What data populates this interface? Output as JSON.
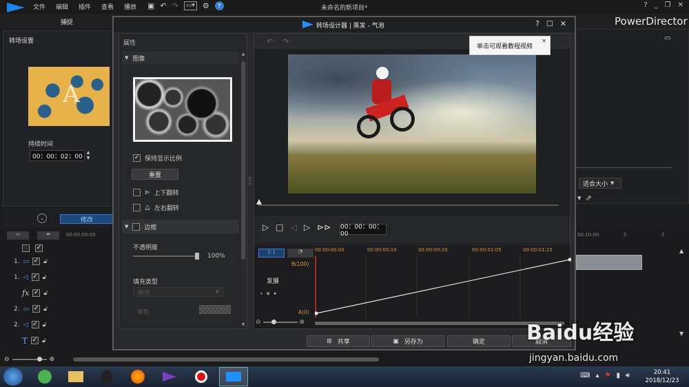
{
  "app": {
    "menus": [
      "文件",
      "编辑",
      "插件",
      "查看",
      "播放"
    ],
    "project_title": "未命名的新项目*",
    "brand": "PowerDirector",
    "tab_capture": "捕捉",
    "tab_edit": "修改"
  },
  "left_panel": {
    "title": "转场设置",
    "duration_label": "持续时间",
    "duration_value": "00：00：02：00",
    "fit_label": "适合大小"
  },
  "timeline_bg": {
    "ruler_start": "00:00:00:00",
    "ruler_end": "00:10:00",
    "tracks": [
      "1.",
      "1.",
      "fx",
      "2.",
      "2.",
      "T"
    ]
  },
  "dialog": {
    "title": "转场设计器 | 蒸发 - 气泡",
    "tooltip": "单击可观看教程视频",
    "props": {
      "header": "属性",
      "image_section": "图像",
      "keep_ratio": "保持显示比例",
      "reset": "重置",
      "flip_v": "上下翻转",
      "flip_h": "左右翻转",
      "border_section": "边框",
      "opacity_label": "不透明度",
      "opacity_value": "100%",
      "fill_type_label": "填充类型",
      "fill_select": "单色",
      "single_color": "单色"
    },
    "player": {
      "timecode": "00：00：00：00"
    },
    "keyframes": {
      "ticks": [
        "00:00:00:00",
        "00:00:00:10",
        "00:00:00:20",
        "00:00:01:05",
        "00:00:01:15"
      ],
      "track_label": "发展",
      "top_value": "B(100)",
      "bottom_value": "A(0)",
      "progress_start": 0,
      "progress_end": 100
    },
    "buttons": {
      "share": "共享",
      "save_as": "另存为",
      "ok": "确定",
      "cancel": "取消"
    }
  },
  "taskbar": {
    "time": "20:41",
    "date": "2018/12/23"
  },
  "watermark": {
    "text": "Baidu经验",
    "url": "jingyan.baidu.com"
  }
}
